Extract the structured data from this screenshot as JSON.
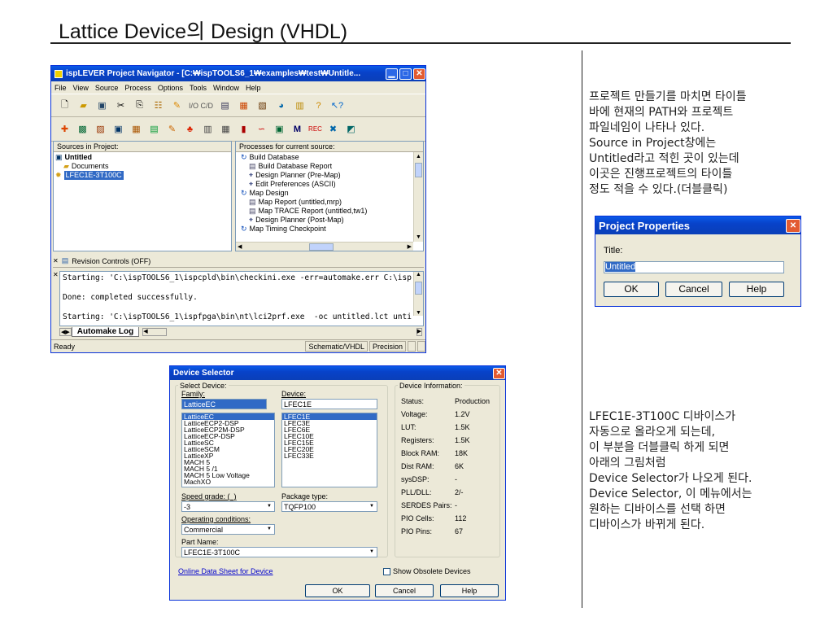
{
  "slide": {
    "title": "Lattice Device의 Design (VHDL)",
    "note1": "프로젝트 만들기를 마치면 타이틀\n바에 현재의 PATH와 프로젝트\n파일네임이 나타나 있다.\nSource in Project창에는\nUntitled라고 적힌 곳이 있는데\n이곳은 진행프로젝트의 타이틀\n정도 적을 수 있다.(더블클릭)",
    "note2": "LFEC1E-3T100C 디바이스가\n자동으로 올라오게 되는데,\n이 부분을 더블클릭 하게 되면\n아래의 그림처럼\nDevice Selector가 나오게 된다.\nDevice Selector, 이 메뉴에서는\n원하는 디바이스를 선택 하면\n디바이스가 바뀌게 된다."
  },
  "navigator": {
    "title": "ispLEVER Project Navigator - [C:₩ispTOOLS6_1₩examples₩test₩Untitle...",
    "menu": [
      "File",
      "View",
      "Source",
      "Process",
      "Options",
      "Tools",
      "Window",
      "Help"
    ],
    "io_label": "I/O C/D",
    "sources_header": "Sources in Project:",
    "sources": [
      "Untitled",
      "Documents",
      "LFEC1E-3T100C"
    ],
    "processes_header": "Processes for current source:",
    "processes": [
      {
        "label": "Build Database",
        "icon": "process-icon",
        "level": 0
      },
      {
        "label": "Build Database Report",
        "icon": "report-icon",
        "level": 1
      },
      {
        "label": "Design Planner (Pre-Map)",
        "icon": "tool-icon",
        "level": 1
      },
      {
        "label": "Edit Preferences (ASCII)",
        "icon": "tool-icon",
        "level": 1
      },
      {
        "label": "Map Design",
        "icon": "process-icon",
        "level": 0
      },
      {
        "label": "Map Report  (untitled,mrp)",
        "icon": "report-icon",
        "level": 1
      },
      {
        "label": "Map TRACE Report  (untitled,tw1)",
        "icon": "report-icon",
        "level": 1
      },
      {
        "label": "Design Planner (Post-Map)",
        "icon": "tool-icon",
        "level": 1
      },
      {
        "label": "Map Timing Checkpoint",
        "icon": "process-icon",
        "level": 0
      }
    ],
    "revision": "Revision Controls (OFF)",
    "log_lines": [
      "Starting: 'C:\\ispTOOLS6_1\\ispcpld\\bin\\checkini.exe -err=automake.err C:\\isp",
      "",
      "Done: completed successfully.",
      "",
      "Starting: 'C:\\ispTOOLS6_1\\ispfpga\\bin\\nt\\lci2prf.exe  -oc untitled.lct unti"
    ],
    "log_tab": "Automake Log",
    "status": "Ready",
    "status_cells": [
      "Schematic/VHDL",
      "Precision"
    ]
  },
  "props": {
    "title": "Project Properties",
    "label": "Title:",
    "value": "Untitled",
    "ok": "OK",
    "cancel": "Cancel",
    "help": "Help"
  },
  "device": {
    "title": "Device Selector",
    "select_device": "Select Device:",
    "family_label": "Family:",
    "family_value": "LatticeEC",
    "families": [
      "LatticeEC",
      "LatticeECP2-DSP",
      "LatticeECP2M-DSP",
      "LatticeECP-DSP",
      "LatticeSC",
      "LatticeSCM",
      "LatticeXP",
      "MACH 5",
      "MACH 5 /1",
      "MACH 5 Low Voltage",
      "MachXO"
    ],
    "device_label": "Device:",
    "device_value": "LFEC1E",
    "devices": [
      "LFEC1E",
      "LFEC3E",
      "LFEC6E",
      "LFEC10E",
      "LFEC15E",
      "LFEC20E",
      "LFEC33E"
    ],
    "speed_label": "Speed grade: (_)",
    "speed_value": "-3",
    "package_label": "Package type:",
    "package_value": "TQFP100",
    "operating_label": "Operating conditions:",
    "operating_value": "Commercial",
    "part_label": "Part Name:",
    "part_value": "LFEC1E-3T100C",
    "datasheet_link": "Online Data Sheet for Device",
    "obsolete": "Show Obsolete Devices",
    "info_header": "Device Information:",
    "info": [
      {
        "k": "Status:",
        "v": "Production"
      },
      {
        "k": "Voltage:",
        "v": "1.2V"
      },
      {
        "k": "LUT:",
        "v": "1.5K"
      },
      {
        "k": "Registers:",
        "v": "1.5K"
      },
      {
        "k": "Block RAM:",
        "v": "18K"
      },
      {
        "k": "Dist RAM:",
        "v": "6K"
      },
      {
        "k": "sysDSP:",
        "v": "-"
      },
      {
        "k": "PLL/DLL:",
        "v": "2/-"
      },
      {
        "k": "SERDES Pairs:",
        "v": "-"
      },
      {
        "k": "PIO Cells:",
        "v": "112"
      },
      {
        "k": "PIO Pins:",
        "v": "67"
      }
    ],
    "ok": "OK",
    "cancel": "Cancel",
    "help": "Help"
  }
}
